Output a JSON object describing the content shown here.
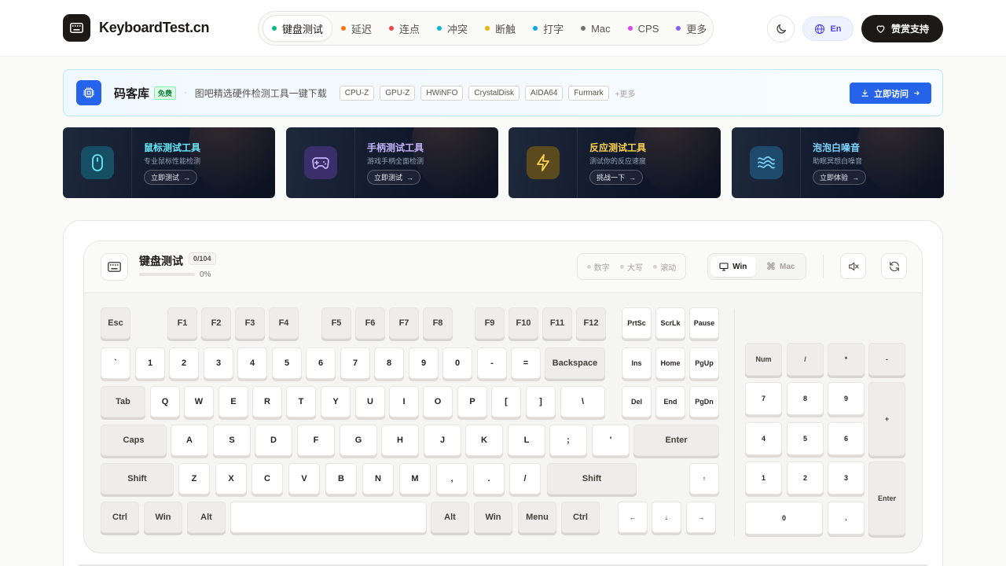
{
  "header": {
    "logo_text": "KeyboardTest.cn",
    "nav": [
      {
        "label": "键盘测试",
        "color": "#10b981",
        "active": true
      },
      {
        "label": "延迟",
        "color": "#f97316"
      },
      {
        "label": "连点",
        "color": "#ef4444"
      },
      {
        "label": "冲突",
        "color": "#06b6d4"
      },
      {
        "label": "断触",
        "color": "#eab308"
      },
      {
        "label": "打字",
        "color": "#0ea5e9"
      },
      {
        "label": "Mac",
        "color": "#78716c"
      },
      {
        "label": "CPS",
        "color": "#d946ef"
      },
      {
        "label": "更多",
        "color": "#8b5cf6"
      }
    ],
    "lang_label": "En",
    "support_label": "赞赏支持"
  },
  "banner": {
    "title": "码客库",
    "badge": "免费",
    "sep": "·",
    "desc": "图吧精选硬件检测工具一键下载",
    "tags": [
      "CPU-Z",
      "GPU-Z",
      "HWiNFO",
      "CrystalDisk",
      "AIDA64",
      "Furmark"
    ],
    "more": "+更多",
    "visit_label": "立即访问"
  },
  "cards": [
    {
      "title": "鼠标测试工具",
      "sub": "专业鼠标性能检测",
      "btn": "立即测试",
      "color": "#67e8f9",
      "icon": "mouse-icon"
    },
    {
      "title": "手柄测试工具",
      "sub": "游戏手柄全面检测",
      "btn": "立即测试",
      "color": "#c4b5fd",
      "icon": "gamepad-icon"
    },
    {
      "title": "反应测试工具",
      "sub": "测试你的反应速度",
      "btn": "挑战一下",
      "color": "#fcd34d",
      "icon": "lightning-icon"
    },
    {
      "title": "泡泡白噪音",
      "sub": "助眠冥想白噪音",
      "btn": "立即体验",
      "color": "#7dd3fc",
      "icon": "waves-icon"
    }
  ],
  "keyboard": {
    "title": "键盘测试",
    "count": "0/104",
    "progress_value": 0,
    "progress_text": "0%",
    "locks": [
      "数字",
      "大写",
      "滚动"
    ],
    "os": {
      "win": "Win",
      "mac": "Mac",
      "selected": "Win"
    }
  },
  "keys": {
    "fn": [
      "Esc",
      "F1",
      "F2",
      "F3",
      "F4",
      "F5",
      "F6",
      "F7",
      "F8",
      "F9",
      "F10",
      "F11",
      "F12"
    ],
    "num": [
      "`",
      "1",
      "2",
      "3",
      "4",
      "5",
      "6",
      "7",
      "8",
      "9",
      "0",
      "-",
      "=",
      "Backspace"
    ],
    "tab": [
      "Tab",
      "Q",
      "W",
      "E",
      "R",
      "T",
      "Y",
      "U",
      "I",
      "O",
      "P",
      "[",
      "]",
      "\\"
    ],
    "caps": [
      "Caps",
      "A",
      "S",
      "D",
      "F",
      "G",
      "H",
      "J",
      "K",
      "L",
      ";",
      "'",
      "Enter"
    ],
    "shift": [
      "Shift",
      "Z",
      "X",
      "C",
      "V",
      "B",
      "N",
      "M",
      ",",
      ".",
      "/",
      "Shift"
    ],
    "ctrl": [
      "Ctrl",
      "Win",
      "Alt",
      "",
      "Alt",
      "Win",
      "Menu",
      "Ctrl"
    ],
    "nav1": [
      "PrtSc",
      "ScrLk",
      "Pause"
    ],
    "nav2": [
      "Ins",
      "Home",
      "PgUp"
    ],
    "nav3": [
      "Del",
      "End",
      "PgDn"
    ],
    "arrows": [
      "↑",
      "←",
      "↓",
      "→"
    ],
    "numpad": [
      "Num",
      "/",
      "*",
      "-",
      "7",
      "8",
      "9",
      "+",
      "4",
      "5",
      "6",
      "1",
      "2",
      "3",
      "Enter",
      "0",
      "."
    ]
  }
}
